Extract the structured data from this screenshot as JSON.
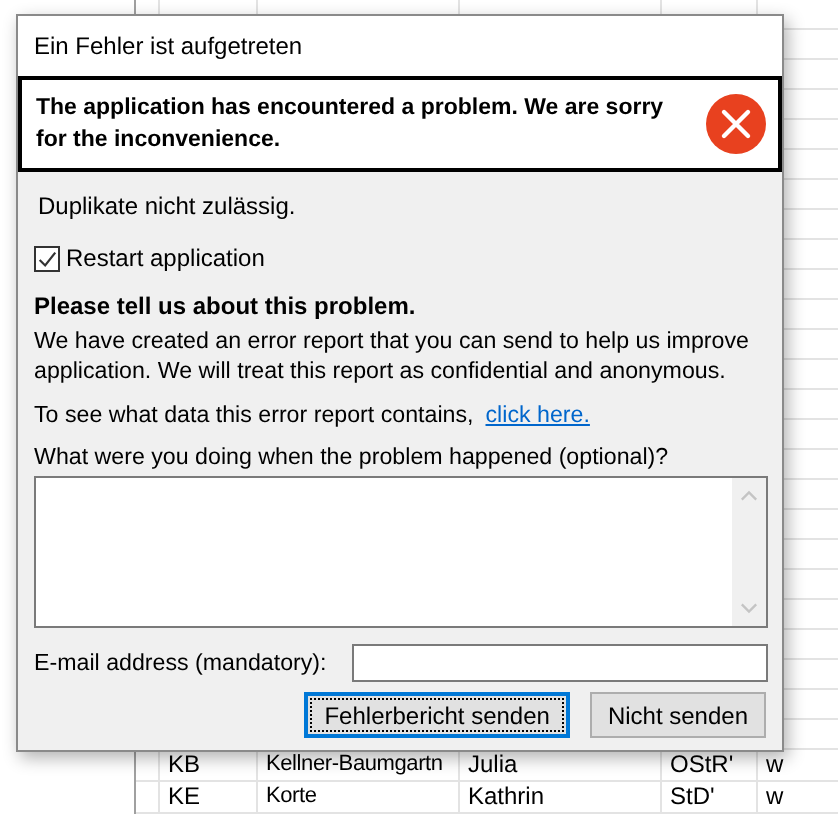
{
  "background_table": {
    "rows": [
      {
        "cells": [
          "KB",
          "Kellner-Baumgartn",
          "Julia",
          "OStR'",
          "w"
        ]
      },
      {
        "cells": [
          "KE",
          "Korte",
          "Kathrin",
          "StD'",
          "w"
        ]
      }
    ]
  },
  "dialog": {
    "title": "Ein Fehler ist aufgetreten",
    "header": "The application has encountered a problem. We are sorry for the inconvenience.",
    "message": "Duplikate nicht zulässig.",
    "restart": {
      "label": "Restart application",
      "checked": true
    },
    "heading": "Please tell us about this problem.",
    "paragraph": "We have created an error report that you can send to help us improve application. We will treat this report as confidential and anonymous.",
    "data_prompt": "To see what data this error report contains,",
    "data_link": "click here.",
    "description_label": "What were you doing when the problem happened (optional)?",
    "email_label": "E-mail address (mandatory):",
    "buttons": [
      {
        "label": "Fehlerbericht senden",
        "focused": true
      },
      {
        "label": "Nicht senden",
        "focused": false
      }
    ]
  }
}
